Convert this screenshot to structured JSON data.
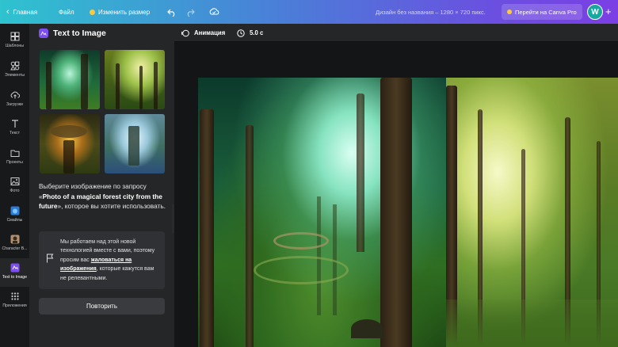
{
  "topbar": {
    "back_label": "Главная",
    "file_label": "Файл",
    "resize_label": "Изменить размер",
    "design_title": "Дизайн без названия – 1280 × 720 пикс.",
    "pro_label": "Перейти на Canva Pro",
    "avatar_letter": "W",
    "plus_glyph": "+"
  },
  "rail": {
    "items": [
      {
        "label": "Шаблоны",
        "icon": "templates-icon"
      },
      {
        "label": "Элементы",
        "icon": "elements-icon"
      },
      {
        "label": "Загрузки",
        "icon": "uploads-icon"
      },
      {
        "label": "Текст",
        "icon": "text-icon"
      },
      {
        "label": "Проекты",
        "icon": "projects-icon"
      },
      {
        "label": "Фото",
        "icon": "photos-icon"
      },
      {
        "label": "Смайлы",
        "icon": "smileys-icon"
      },
      {
        "label": "Character B...",
        "icon": "character-builder-icon"
      },
      {
        "label": "Text to Image",
        "icon": "text-to-image-icon"
      },
      {
        "label": "Приложения",
        "icon": "apps-icon"
      }
    ]
  },
  "panel": {
    "title": "Text to Image",
    "desc_prefix": "Выберите изображение по запросу «",
    "prompt": "Photo of a magical forest city from the future",
    "desc_suffix": "», которое вы хотите использовать.",
    "notice_before": "Мы работаем над этой новой технологией вместе с вами, поэтому просим вас ",
    "notice_link": "жаловаться на изображения",
    "notice_after": ", которые кажутся вам не релевантными.",
    "retry_label": "Повторить",
    "collapse_glyph": "‹"
  },
  "toolbar": {
    "animation_label": "Анимация",
    "duration_label": "5.0 с"
  },
  "colors": {
    "accent": "#7d4ef0",
    "panel_bg": "#252627",
    "rail_bg": "#18191b",
    "canvas_bg": "#141517"
  }
}
